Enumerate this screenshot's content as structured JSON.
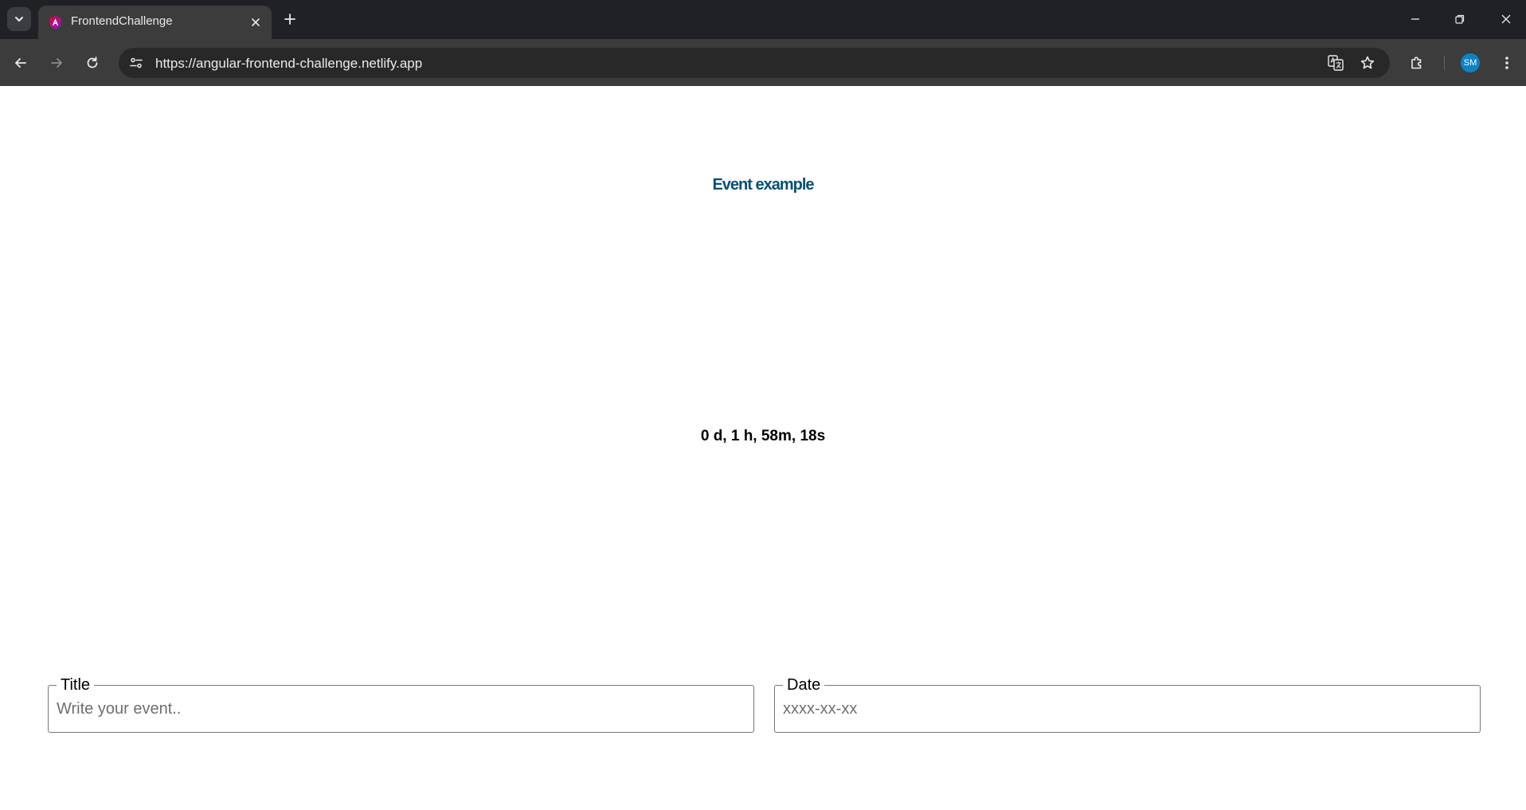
{
  "browser": {
    "tab_title": "FrontendChallenge",
    "url": "https://angular-frontend-challenge.netlify.app",
    "profile_initials": "SM"
  },
  "event": {
    "title": "Event example",
    "countdown": "0 d, 1 h, 58m, 18s"
  },
  "form": {
    "title_label": "Title",
    "title_placeholder": "Write your event..",
    "title_value": "",
    "date_label": "Date",
    "date_placeholder": "xxxx-xx-xx",
    "date_value": ""
  },
  "colors": {
    "title_color": "#07506f",
    "countdown_color": "#000000",
    "avatar_bg": "#0b84c6"
  }
}
